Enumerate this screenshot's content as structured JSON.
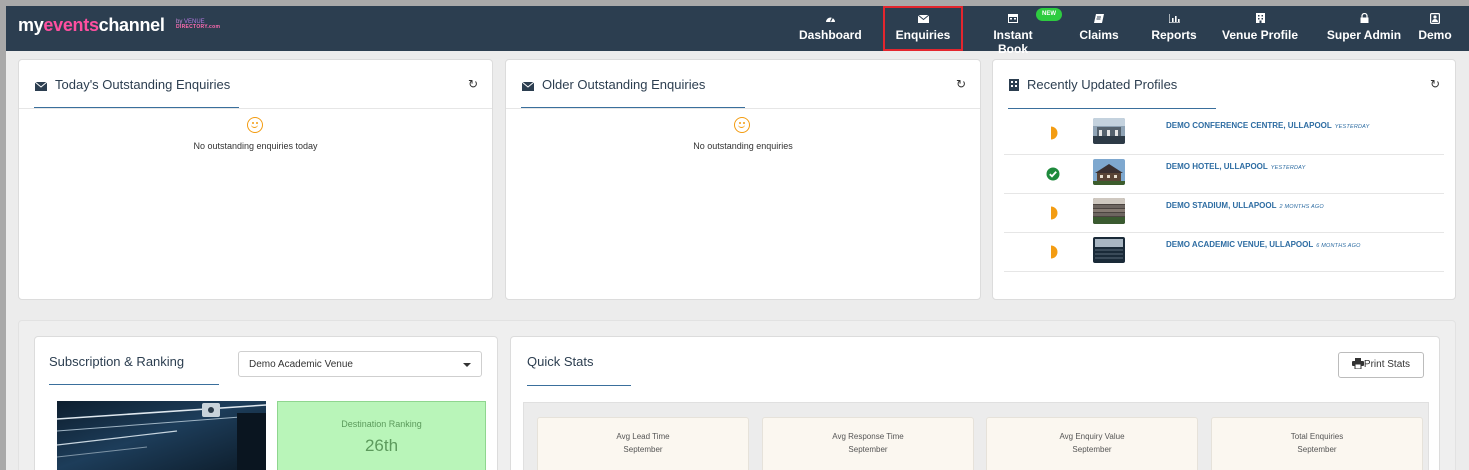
{
  "brand": {
    "part1": "my",
    "part2": "events",
    "part3": "channel",
    "by": "by",
    "sub_top": "VENUE",
    "sub_bottom": "DIRECTORY.com"
  },
  "nav": {
    "badge_new": "NEW",
    "items": [
      {
        "label": "Dashboard",
        "icon": "gauge-icon"
      },
      {
        "label": "Enquiries",
        "icon": "envelope-icon",
        "active": true
      },
      {
        "label": "Instant Book",
        "icon": "calendar-icon"
      },
      {
        "label": "Claims",
        "icon": "ticket-icon"
      },
      {
        "label": "Reports",
        "icon": "bar-chart-icon"
      },
      {
        "label": "Venue Profile",
        "icon": "building-icon"
      },
      {
        "label": "Super Admin",
        "icon": "lock-icon"
      },
      {
        "label": "Demo",
        "icon": "user-badge-icon"
      }
    ]
  },
  "panels": {
    "today": {
      "title": "Today's Outstanding Enquiries",
      "empty": "No outstanding enquiries today"
    },
    "older": {
      "title": "Older Outstanding Enquiries",
      "empty": "No outstanding enquiries"
    },
    "recent": {
      "title": "Recently Updated Profiles",
      "items": [
        {
          "name": "DEMO CONFERENCE CENTRE, ULLAPOOL",
          "when": "YESTERDAY",
          "status": "partial"
        },
        {
          "name": "DEMO HOTEL, ULLAPOOL",
          "when": "YESTERDAY",
          "status": "complete"
        },
        {
          "name": "DEMO STADIUM, ULLAPOOL",
          "when": "2 MONTHS AGO",
          "status": "partial"
        },
        {
          "name": "DEMO ACADEMIC VENUE, ULLAPOOL",
          "when": "6 MONTHS AGO",
          "status": "partial"
        }
      ]
    }
  },
  "subscription": {
    "title": "Subscription & Ranking",
    "selected_venue": "Demo Academic Venue",
    "dest_label": "Destination Ranking",
    "dest_value": "26th"
  },
  "quick_stats": {
    "title": "Quick Stats",
    "print_label": "Print Stats",
    "cards": [
      {
        "title": "Avg Lead Time",
        "month": "September"
      },
      {
        "title": "Avg Response Time",
        "month": "September"
      },
      {
        "title": "Avg Enquiry Value",
        "month": "September"
      },
      {
        "title": "Total Enquiries",
        "month": "September"
      }
    ]
  },
  "colors": {
    "navbar": "#2c3e50",
    "brand_accent": "#ff4fa0",
    "active_outline": "#e3262e",
    "link": "#2d6ca2",
    "smiley": "#f39c12",
    "ranking_bg": "#b9f5b9"
  }
}
